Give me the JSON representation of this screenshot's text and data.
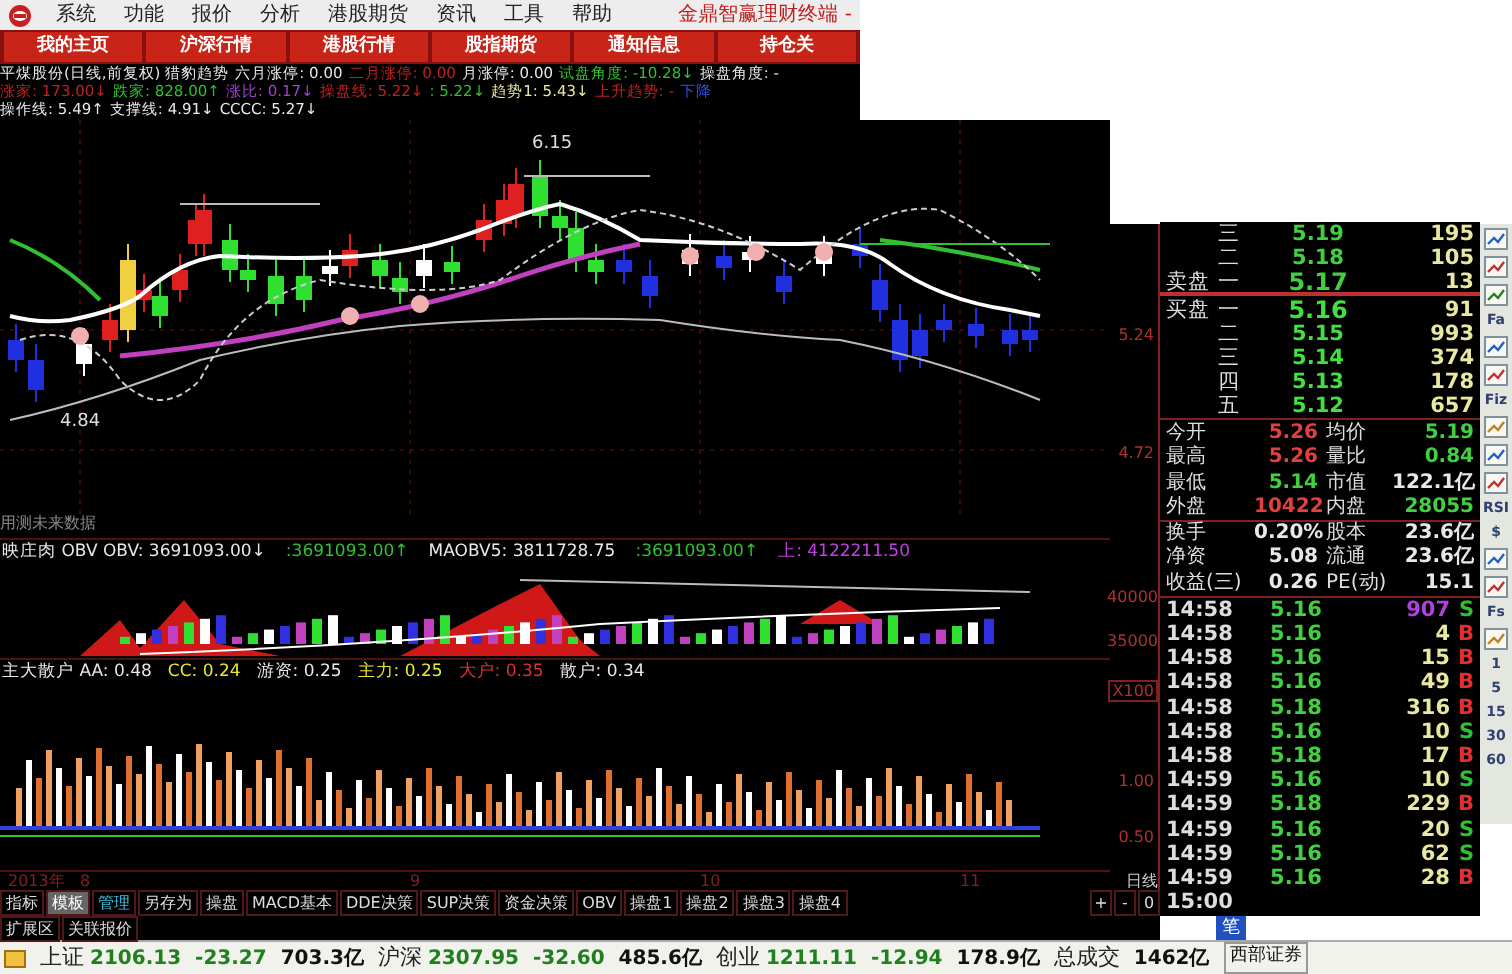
{
  "menu": {
    "items": [
      "系统",
      "功能",
      "报价",
      "分析",
      "港股期货",
      "资讯",
      "工具",
      "帮助"
    ],
    "title": "金鼎智赢理财终端 -"
  },
  "tabs": [
    {
      "label": "我的主页",
      "selected": false
    },
    {
      "label": "沪深行情",
      "selected": false
    },
    {
      "label": "港股行情",
      "selected": false
    },
    {
      "label": "股指期货",
      "selected": false
    },
    {
      "label": "通知信息",
      "selected": false
    },
    {
      "label": "持仓关",
      "selected": false
    }
  ],
  "info_lines": [
    [
      {
        "text": "平煤股份(日线,前复权) 猎豹趋势",
        "color": "#e8e8e8"
      },
      {
        "text": "六月涨停: 0.00",
        "color": "#e8e8e8"
      },
      {
        "text": "二月涨停: 0.00",
        "color": "#c02020"
      },
      {
        "text": "月涨停: 0.00",
        "color": "#e8e8e8"
      },
      {
        "text": "试盘角度: -10.28↓",
        "color": "#30c030"
      },
      {
        "text": "操盘角度: -",
        "color": "#e8e8e8"
      }
    ],
    [
      {
        "text": "涨家: 173.00↓",
        "color": "#c02020"
      },
      {
        "text": "跌家: 828.00↑",
        "color": "#30c030"
      },
      {
        "text": "涨比: 0.17↓",
        "color": "#a040d0"
      },
      {
        "text": "操盘线: 5.22↓",
        "color": "#c02020"
      },
      {
        "text": ": 5.22↓",
        "color": "#30c030"
      },
      {
        "text": "趋势1: 5.43↓",
        "color": "#e8e8a0"
      },
      {
        "text": "上升趋势: -",
        "color": "#c02020"
      },
      {
        "text": "下降",
        "color": "#3050e0"
      }
    ],
    [
      {
        "text": "操作线: 5.49↑",
        "color": "#e8e8e8"
      },
      {
        "text": "支撑线: 4.91↓",
        "color": "#e8e8e8"
      },
      {
        "text": "CCCC: 5.27↓",
        "color": "#e8e8e8"
      }
    ]
  ],
  "main_chart": {
    "high_label": "6.15",
    "low_label": "4.84",
    "note": "用测未来数据"
  },
  "obv_line": [
    {
      "text": "映庄肉 OBV OBV: 3691093.00↓",
      "color": "#e8e8e8"
    },
    {
      "text": ":3691093.00↑",
      "color": "#30c030"
    },
    {
      "text": "MAOBV5: 3811728.75",
      "color": "#e8e8e8"
    },
    {
      "text": ":3691093.00↑",
      "color": "#30c030"
    },
    {
      "text": "上: 4122211.50",
      "color": "#c040e0"
    }
  ],
  "indicator_line": [
    {
      "text": "主大散户 AA: 0.48",
      "color": "#e8e8e8"
    },
    {
      "text": "CC: 0.24",
      "color": "#e8e830"
    },
    {
      "text": "游资: 0.25",
      "color": "#e8e8e8"
    },
    {
      "text": "主力: 0.25",
      "color": "#e8e830"
    },
    {
      "text": "大户: 0.35",
      "color": "#e03030"
    },
    {
      "text": "散户: 0.34",
      "color": "#e8e8e8"
    }
  ],
  "axis": {
    "price": [
      "5.24",
      "4.72"
    ],
    "obv": [
      "40000",
      "35000"
    ],
    "obv_scale": "X100",
    "indicator": [
      "1.00",
      "0.50"
    ],
    "period": "日线"
  },
  "dates": [
    "2013年",
    "8",
    "9",
    "10",
    "11"
  ],
  "order_book": [
    {
      "level": "三",
      "price": "5.19",
      "volume": "195",
      "kind": "sell"
    },
    {
      "level": "二",
      "price": "5.18",
      "volume": "105",
      "kind": "sell"
    },
    {
      "side": "卖盘",
      "level": "一",
      "price": "5.17",
      "volume": "13",
      "kind": "sell"
    },
    {
      "side": "买盘",
      "level": "一",
      "price": "5.16",
      "volume": "91",
      "kind": "buy"
    },
    {
      "level": "二",
      "price": "5.15",
      "volume": "993",
      "kind": "buy"
    },
    {
      "level": "三",
      "price": "5.14",
      "volume": "374",
      "kind": "buy"
    },
    {
      "level": "四",
      "price": "5.13",
      "volume": "178",
      "kind": "buy"
    },
    {
      "level": "五",
      "price": "5.12",
      "volume": "657",
      "kind": "buy"
    }
  ],
  "stats": [
    [
      {
        "label": "今开",
        "value": "5.26",
        "color": "#e04040"
      },
      {
        "label": "均价",
        "value": "5.19",
        "color": "#40d040"
      }
    ],
    [
      {
        "label": "最高",
        "value": "5.26",
        "color": "#e04040"
      },
      {
        "label": "量比",
        "value": "0.84",
        "color": "#40d040"
      }
    ],
    [
      {
        "label": "最低",
        "value": "5.14",
        "color": "#40d040"
      },
      {
        "label": "市值",
        "value": "122.1亿",
        "color": "#e8e8e8"
      }
    ],
    [
      {
        "label": "外盘",
        "value": "10422",
        "color": "#e04040"
      },
      {
        "label": "内盘",
        "value": "28055",
        "color": "#40d040"
      }
    ],
    [
      {
        "label": "换手",
        "value": "0.20%",
        "color": "#e8e8e8"
      },
      {
        "label": "股本",
        "value": "23.6亿",
        "color": "#e8e8e8"
      }
    ],
    [
      {
        "label": "净资",
        "value": "5.08",
        "color": "#e8e8e8"
      },
      {
        "label": "流通",
        "value": "23.6亿",
        "color": "#e8e8e8"
      }
    ],
    [
      {
        "label": "收益(三)",
        "value": "0.26",
        "color": "#e8e8e8"
      },
      {
        "label": "PE(动)",
        "value": "15.1",
        "color": "#e8e8e8"
      }
    ]
  ],
  "trades": [
    {
      "time": "14:58",
      "price": "5.16",
      "volume": "907",
      "large": true,
      "side": "S",
      "color": "#30c030"
    },
    {
      "time": "14:58",
      "price": "5.16",
      "volume": "4",
      "large": false,
      "side": "B",
      "color": "#e03030"
    },
    {
      "time": "14:58",
      "price": "5.16",
      "volume": "15",
      "large": false,
      "side": "B",
      "color": "#e03030"
    },
    {
      "time": "14:58",
      "price": "5.16",
      "volume": "49",
      "large": false,
      "side": "B",
      "color": "#e03030"
    },
    {
      "time": "14:58",
      "price": "5.18",
      "volume": "316",
      "large": false,
      "side": "B",
      "color": "#e03030"
    },
    {
      "time": "14:58",
      "price": "5.16",
      "volume": "10",
      "large": false,
      "side": "S",
      "color": "#30c030"
    },
    {
      "time": "14:58",
      "price": "5.18",
      "volume": "17",
      "large": false,
      "side": "B",
      "color": "#e03030"
    },
    {
      "time": "14:59",
      "price": "5.16",
      "volume": "10",
      "large": false,
      "side": "S",
      "color": "#30c030"
    },
    {
      "time": "14:59",
      "price": "5.18",
      "volume": "229",
      "large": false,
      "side": "B",
      "color": "#e03030"
    },
    {
      "time": "14:59",
      "price": "5.16",
      "volume": "20",
      "large": false,
      "side": "S",
      "color": "#30c030"
    },
    {
      "time": "14:59",
      "price": "5.16",
      "volume": "62",
      "large": false,
      "side": "S",
      "color": "#30c030"
    },
    {
      "time": "14:59",
      "price": "5.16",
      "volume": "28",
      "large": false,
      "side": "B",
      "color": "#e03030"
    }
  ],
  "close_time": "15:00",
  "detail_tab": {
    "label": "笔",
    "selected": true
  },
  "side_tools": [
    {
      "kind": "icon"
    },
    {
      "kind": "icon"
    },
    {
      "kind": "icon"
    },
    {
      "kind": "text",
      "text": "Fa"
    },
    {
      "kind": "icon"
    },
    {
      "kind": "icon"
    },
    {
      "kind": "text",
      "text": "Fiz"
    },
    {
      "kind": "icon"
    },
    {
      "kind": "icon"
    },
    {
      "kind": "icon"
    },
    {
      "kind": "text",
      "text": "RSI"
    },
    {
      "kind": "text",
      "text": "$"
    },
    {
      "kind": "icon"
    },
    {
      "kind": "icon"
    },
    {
      "kind": "text",
      "text": "Fs"
    },
    {
      "kind": "icon"
    },
    {
      "kind": "text",
      "text": "1"
    },
    {
      "kind": "text",
      "text": "5"
    },
    {
      "kind": "text",
      "text": "15"
    },
    {
      "kind": "text",
      "text": "30"
    },
    {
      "kind": "text",
      "text": "60"
    }
  ],
  "toolbar": [
    {
      "label": "指标",
      "selected": false
    },
    {
      "label": "模板",
      "selected": true
    },
    {
      "label": "管理",
      "selected": false
    },
    {
      "label": "另存为",
      "selected": false
    },
    {
      "label": "操盘",
      "selected": false
    },
    {
      "label": "MACD基本",
      "selected": false
    },
    {
      "label": "DDE决策",
      "selected": false
    },
    {
      "label": "SUP决策",
      "selected": false
    },
    {
      "label": "资金决策",
      "selected": false
    },
    {
      "label": "OBV",
      "selected": false
    },
    {
      "label": "操盘1",
      "selected": false
    },
    {
      "label": "操盘2",
      "selected": false
    },
    {
      "label": "操盘3",
      "selected": false
    },
    {
      "label": "操盘4",
      "selected": false
    }
  ],
  "zoom_buttons": [
    "+",
    "-",
    "0"
  ],
  "extra_tabs": [
    "扩展区",
    "关联报价"
  ],
  "status_bar": [
    {
      "name": "上证",
      "value": "2106.13",
      "change": "-23.27",
      "amount": "703.3亿"
    },
    {
      "name": "沪深",
      "value": "2307.95",
      "change": "-32.60",
      "amount": "485.6亿"
    },
    {
      "name": "创业",
      "value": "1211.11",
      "change": "-12.94",
      "amount": "178.9亿"
    }
  ],
  "total": {
    "label": "总成交",
    "value": "1462亿"
  },
  "broker": "西部证券"
}
